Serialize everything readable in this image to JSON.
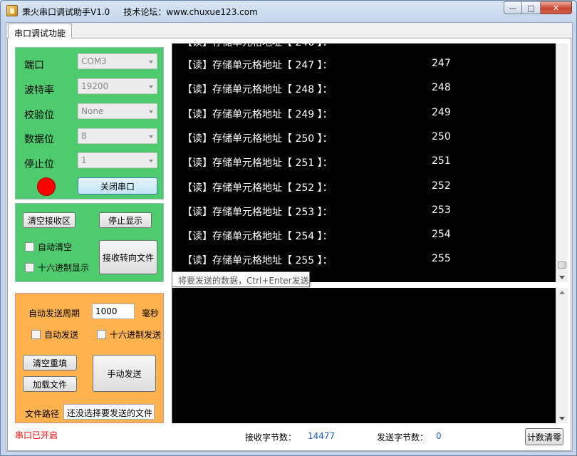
{
  "window": {
    "title": "秉火串口调试助手V1.0     技术论坛：www.chuxue123.com"
  },
  "tabs": [
    "串口调试功能"
  ],
  "serial": {
    "port_label": "端口",
    "port_value": "COM3",
    "baud_label": "波特率",
    "baud_value": "19200",
    "parity_label": "校验位",
    "parity_value": "None",
    "databits_label": "数据位",
    "databits_value": "8",
    "stopbits_label": "停止位",
    "stopbits_value": "1",
    "led_color": "#ff0000",
    "toggle_button": "关闭串口"
  },
  "receive": {
    "clear_button": "清空接收区",
    "stop_button": "停止显示",
    "auto_clear": "自动清空",
    "hex_display": "十六进制显示",
    "redirect_button": "接收转向文件",
    "lines": [
      {
        "text": "【读】存储单元格地址【 247 】：",
        "value": "247"
      },
      {
        "text": "【读】存储单元格地址【 248 】：",
        "value": "248"
      },
      {
        "text": "【读】存储单元格地址【 249 】：",
        "value": "249"
      },
      {
        "text": "【读】存储单元格地址【 250 】：",
        "value": "250"
      },
      {
        "text": "【读】存储单元格地址【 251 】：",
        "value": "251"
      },
      {
        "text": "【读】存储单元格地址【 252 】：",
        "value": "252"
      },
      {
        "text": "【读】存储单元格地址【 253 】：",
        "value": "253"
      },
      {
        "text": "【读】存储单元格地址【 254 】：",
        "value": "254"
      },
      {
        "text": "【读】存储单元格地址【 255 】：",
        "value": "255"
      }
    ]
  },
  "send": {
    "tooltip": "将要发送的数据，Ctrl+Enter发送",
    "period_label": "自动发送周期",
    "period_value": "1000",
    "period_unit": "毫秒",
    "auto_send": "自动发送",
    "hex_send": "十六进制发送",
    "clear_button": "清空重填",
    "load_button": "加载文件",
    "manual_button": "手动发送",
    "path_label": "文件路径",
    "path_value": "还没选择要发送的文件"
  },
  "status": {
    "port_state": "串口已开启",
    "recv_label": "接收字节数：",
    "recv_count": "14477",
    "send_label": "发送字节数：",
    "send_count": "0",
    "reset_button": "计数清零"
  }
}
